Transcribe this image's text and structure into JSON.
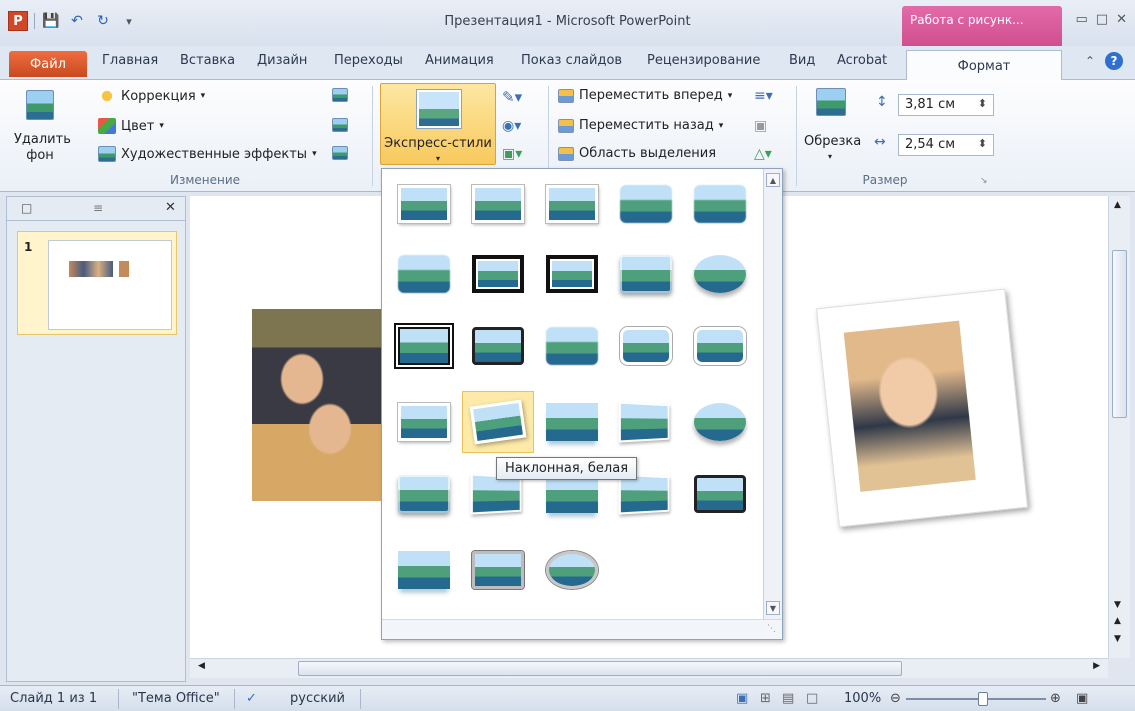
{
  "window": {
    "title": "Презентация1 - Microsoft PowerPoint",
    "contextual_tab": "Работа с рисунк...",
    "app_logo": "P"
  },
  "tabs": {
    "file": "Файл",
    "items": [
      "Главная",
      "Вставка",
      "Дизайн",
      "Переходы",
      "Анимация",
      "Показ слайдов",
      "Рецензирование",
      "Вид",
      "Acrobat"
    ],
    "format": "Формат"
  },
  "ribbon": {
    "remove_bg": "Удалить фон",
    "correction": "Коррекция",
    "color": "Цвет",
    "art_effects": "Художественные эффекты",
    "group_change": "Изменение",
    "express_styles": "Экспресс-стили",
    "bring_forward": "Переместить вперед",
    "send_backward": "Переместить назад",
    "selection_pane": "Область выделения",
    "crop": "Обрезка",
    "height": "3,81 см",
    "width": "2,54 см",
    "group_size": "Размер"
  },
  "gallery": {
    "hovered_style": "Наклонная, белая"
  },
  "slides": {
    "current_number": "1"
  },
  "status": {
    "slide": "Слайд 1 из 1",
    "theme": "\"Тема Office\"",
    "language": "русский",
    "zoom": "100%",
    "zoom_level": 1.0
  },
  "icons": [
    "save-icon",
    "undo-icon",
    "redo-icon",
    "minimize-icon",
    "restore-icon",
    "close-icon",
    "help-icon"
  ]
}
